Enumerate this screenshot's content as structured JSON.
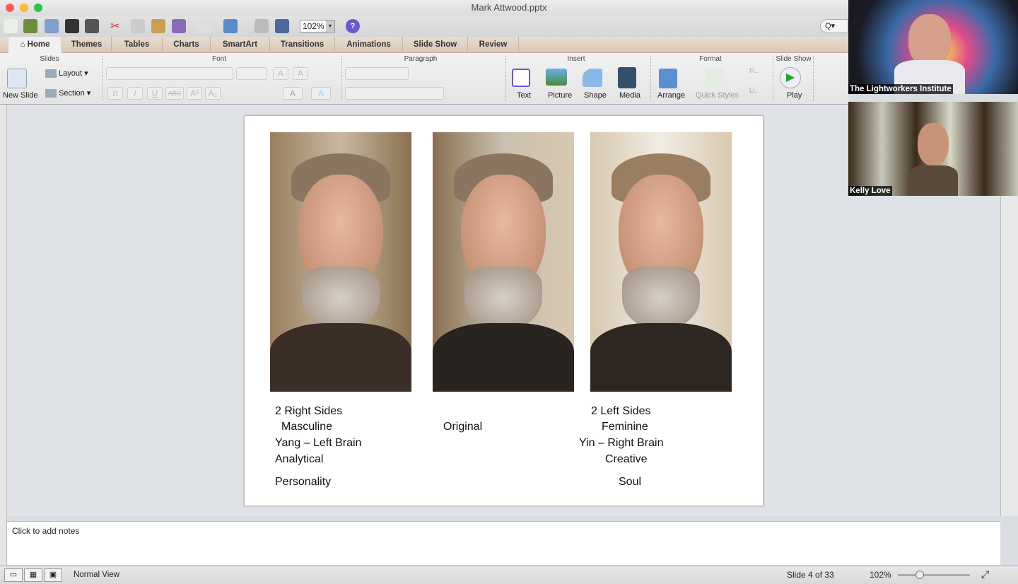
{
  "window": {
    "title": "Mark Attwood.pptx"
  },
  "toolbar": {
    "zoom": "102%",
    "help": "?",
    "search": "Q▾"
  },
  "tabs": [
    {
      "label": "Home",
      "icon": "home-icon"
    },
    {
      "label": "Themes"
    },
    {
      "label": "Tables"
    },
    {
      "label": "Charts"
    },
    {
      "label": "SmartArt"
    },
    {
      "label": "Transitions"
    },
    {
      "label": "Animations"
    },
    {
      "label": "Slide Show"
    },
    {
      "label": "Review"
    }
  ],
  "ribbon": {
    "groups": {
      "slides": "Slides",
      "font": "Font",
      "paragraph": "Paragraph",
      "insert": "Insert",
      "format": "Format",
      "slideshow": "Slide Show"
    },
    "new_slide": "New Slide",
    "layout": "Layout",
    "section": "Section",
    "font_buttons": [
      "B",
      "I",
      "U",
      "ABC",
      "A²",
      "A₂",
      "A",
      "A"
    ],
    "insert": [
      "Text",
      "Picture",
      "Shape",
      "Media"
    ],
    "format": [
      "Arrange",
      "Quick Styles",
      "Fi..",
      "Li.."
    ],
    "play": "Play"
  },
  "slide": {
    "left": [
      "2 Right Sides",
      "Masculine",
      "Yang – Left Brain",
      "Analytical",
      "Personality"
    ],
    "middle": "Original",
    "right": [
      "2 Left Sides",
      "Feminine",
      "Yin – Right Brain",
      "Creative",
      "Soul"
    ]
  },
  "notes": {
    "placeholder": "Click to add notes"
  },
  "status": {
    "view": "Normal View",
    "slide": "Slide 4 of 33",
    "zoom": "102%"
  },
  "video": [
    {
      "name": "The Lightworkers Institute"
    },
    {
      "name": "Kelly Love"
    }
  ]
}
